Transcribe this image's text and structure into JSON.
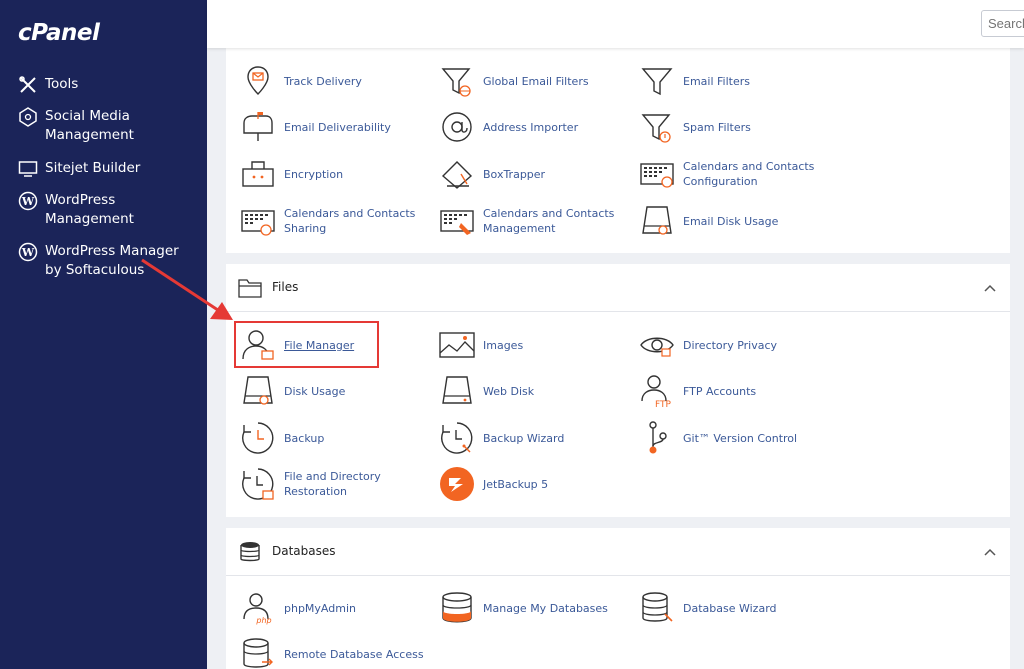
{
  "brand": {
    "logo": "cPanel"
  },
  "sidebar": {
    "items": [
      {
        "label": "Tools",
        "icon": "tools-icon"
      },
      {
        "label": "Social Media Management",
        "icon": "social-media-icon"
      },
      {
        "label": "Sitejet Builder",
        "icon": "sitejet-icon"
      },
      {
        "label": "WordPress Management",
        "icon": "wordpress-icon"
      },
      {
        "label": "WordPress Manager by Softaculous",
        "icon": "wordpress-icon"
      }
    ]
  },
  "search": {
    "placeholder": "Search"
  },
  "email": {
    "items": [
      {
        "label": "Track Delivery",
        "icon": "track-delivery-icon"
      },
      {
        "label": "Global Email Filters",
        "icon": "global-filter-icon"
      },
      {
        "label": "Email Filters",
        "icon": "filter-icon"
      },
      {
        "label": "Email Deliverability",
        "icon": "mailbox-icon"
      },
      {
        "label": "Address Importer",
        "icon": "at-sign-icon"
      },
      {
        "label": "Spam Filters",
        "icon": "spam-filter-icon"
      },
      {
        "label": "Encryption",
        "icon": "encryption-icon"
      },
      {
        "label": "BoxTrapper",
        "icon": "boxtrapper-icon"
      },
      {
        "label": "Calendars and Contacts Configuration",
        "icon": "calendar-config-icon"
      },
      {
        "label": "Calendars and Contacts Sharing",
        "icon": "calendar-sharing-icon"
      },
      {
        "label": "Calendars and Contacts Management",
        "icon": "calendar-management-icon"
      },
      {
        "label": "Email Disk Usage",
        "icon": "disk-usage-icon"
      }
    ]
  },
  "files": {
    "title": "Files",
    "items": [
      {
        "label": "File Manager",
        "icon": "file-manager-icon"
      },
      {
        "label": "Images",
        "icon": "images-icon"
      },
      {
        "label": "Directory Privacy",
        "icon": "eye-icon"
      },
      {
        "label": "Disk Usage",
        "icon": "disk-usage-icon"
      },
      {
        "label": "Web Disk",
        "icon": "web-disk-icon"
      },
      {
        "label": "FTP Accounts",
        "icon": "ftp-accounts-icon"
      },
      {
        "label": "Backup",
        "icon": "backup-icon"
      },
      {
        "label": "Backup Wizard",
        "icon": "backup-wizard-icon"
      },
      {
        "label": "Git™ Version Control",
        "icon": "git-icon"
      },
      {
        "label": "File and Directory Restoration",
        "icon": "restoration-icon"
      },
      {
        "label": "JetBackup 5",
        "icon": "jetbackup-icon"
      }
    ]
  },
  "databases": {
    "title": "Databases",
    "items": [
      {
        "label": "phpMyAdmin",
        "icon": "phpmyadmin-icon"
      },
      {
        "label": "Manage My Databases",
        "icon": "database-icon"
      },
      {
        "label": "Database Wizard",
        "icon": "database-wizard-icon"
      },
      {
        "label": "Remote Database Access",
        "icon": "remote-database-icon"
      }
    ]
  },
  "colors": {
    "sidebar_bg": "#1b2459",
    "accent_orange": "#f26522",
    "link_blue": "#3b5998",
    "highlight_red": "#e53935"
  }
}
